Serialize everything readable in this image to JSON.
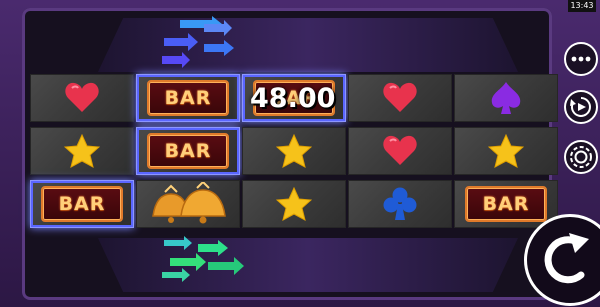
{
  "status_bar": {
    "time": "13:43"
  },
  "reels": {
    "bar_label": "BAR",
    "rows": [
      [
        "heart",
        "bar",
        "bar",
        "heart",
        "spade"
      ],
      [
        "star",
        "bar",
        "star",
        "heart",
        "star"
      ],
      [
        "bar",
        "bells",
        "star",
        "club",
        "bar"
      ]
    ],
    "winning_cells": [
      [
        0,
        1
      ],
      [
        0,
        2
      ],
      [
        1,
        1
      ],
      [
        2,
        0
      ]
    ]
  },
  "win": {
    "amount": "48.00"
  },
  "controls": {
    "menu_icon": "more-dots-icon",
    "autoplay_icon": "autoplay-icon",
    "bet_icon": "chip-icon",
    "spin_icon": "spin-arrow-icon"
  },
  "colors": {
    "heart": "#e8334d",
    "spade": "#8a2be2",
    "club": "#1f5bd6",
    "star": "#f6c21a",
    "win_highlight": "#5a66ff",
    "arrow_top": "#3aa0ff",
    "arrow_bottom": "#2de08a"
  }
}
